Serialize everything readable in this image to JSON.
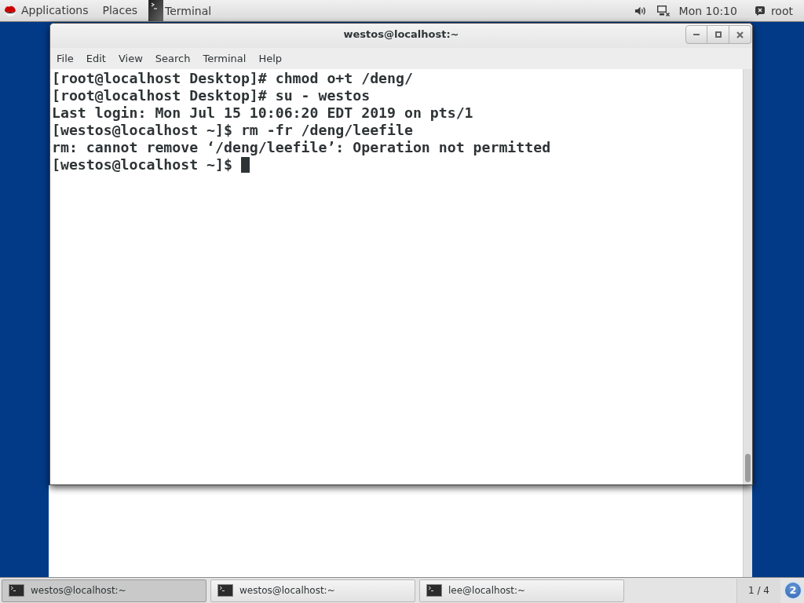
{
  "top_bar": {
    "menus": [
      {
        "label": "Applications"
      },
      {
        "label": "Places"
      }
    ],
    "app": {
      "label": "Terminal"
    },
    "clock": "Mon 10:10",
    "user": "root"
  },
  "window": {
    "title": "westos@localhost:~",
    "menu": [
      "File",
      "Edit",
      "View",
      "Search",
      "Terminal",
      "Help"
    ],
    "terminal": {
      "lines": [
        "[root@localhost Desktop]# chmod o+t /deng/",
        "[root@localhost Desktop]# su - westos",
        "Last login: Mon Jul 15 10:06:20 EDT 2019 on pts/1",
        "[westos@localhost ~]$ rm -fr /deng/leefile",
        "rm: cannot remove ‘/deng/leefile’: Operation not permitted",
        "[westos@localhost ~]$"
      ],
      "cursor": true
    }
  },
  "taskbar": {
    "items": [
      {
        "label": "westos@localhost:~",
        "selected": true
      },
      {
        "label": "westos@localhost:~",
        "selected": false
      },
      {
        "label": "lee@localhost:~",
        "selected": false
      }
    ],
    "workspace": "1 / 4",
    "notifications": "2"
  }
}
